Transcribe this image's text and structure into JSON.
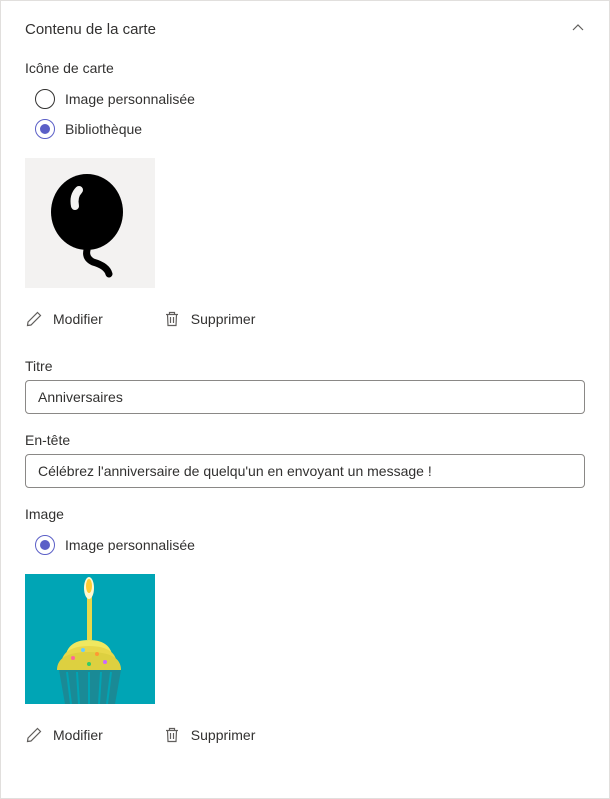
{
  "panel": {
    "title": "Contenu de la carte"
  },
  "cardIcon": {
    "label": "Icône de carte",
    "options": {
      "custom": "Image personnalisée",
      "library": "Bibliothèque"
    },
    "selected": "library",
    "iconName": "balloon-icon"
  },
  "actions": {
    "edit": "Modifier",
    "delete": "Supprimer"
  },
  "titleField": {
    "label": "Titre",
    "value": "Anniversaires"
  },
  "headerField": {
    "label": "En-tête",
    "value": "Célébrez l'anniversaire de quelqu'un en envoyant un message !"
  },
  "imageSection": {
    "label": "Image",
    "options": {
      "custom": "Image personnalisée"
    },
    "selected": "custom"
  }
}
